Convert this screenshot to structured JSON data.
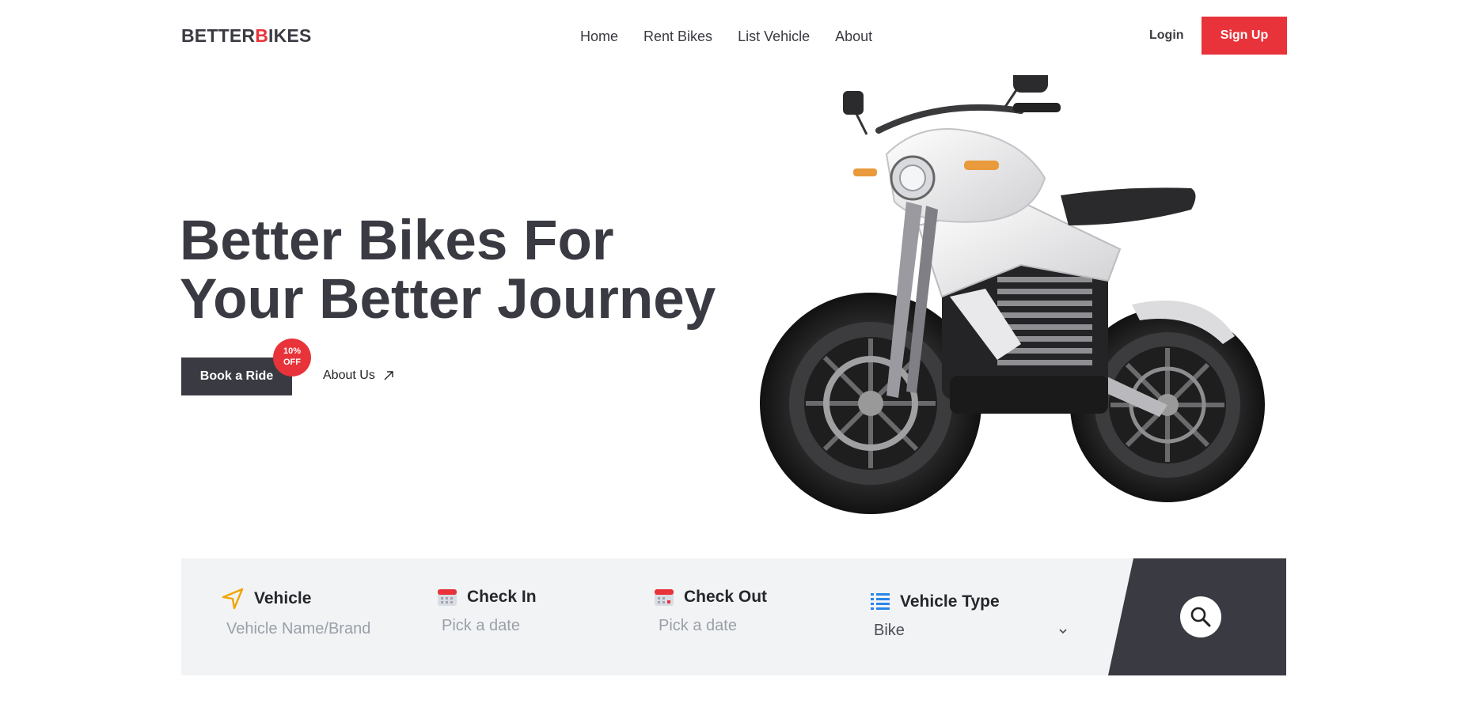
{
  "logo": {
    "part1": "BETTER",
    "accent": "B",
    "part2": "IKES"
  },
  "nav": [
    {
      "label": "Home"
    },
    {
      "label": "Rent Bikes"
    },
    {
      "label": "List Vehicle"
    },
    {
      "label": "About"
    }
  ],
  "auth": {
    "login_label": "Login",
    "signup_label": "Sign Up"
  },
  "hero": {
    "title_line1": "Better Bikes For",
    "title_line2": "Your Better Journey",
    "book_label": "Book a Ride",
    "badge_line1": "10%",
    "badge_line2": "OFF",
    "about_label": "About Us"
  },
  "search": {
    "vehicle": {
      "title": "Vehicle",
      "placeholder": "Vehicle Name/Brand",
      "icon": "navigation-arrow-icon"
    },
    "checkin": {
      "title": "Check In",
      "placeholder": "Pick a date",
      "icon": "calendar-icon"
    },
    "checkout": {
      "title": "Check Out",
      "placeholder": "Pick a date",
      "icon": "calendar-icon"
    },
    "type": {
      "title": "Vehicle Type",
      "value": "Bike",
      "icon": "list-icon"
    },
    "search_icon": "search-icon"
  },
  "colors": {
    "accent": "#e8333a",
    "dark": "#3a3b42",
    "panel": "#f2f3f5",
    "nav_icon": "#f0a500",
    "list_icon": "#2a86e8"
  }
}
